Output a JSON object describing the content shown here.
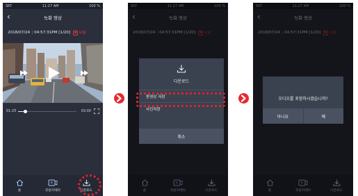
{
  "status": {
    "carrier": "SKT",
    "time": "11:27 AM",
    "battery": "100 %"
  },
  "header": {
    "title": "녹화 영상"
  },
  "recording": {
    "date": "2018/07/24",
    "time_count": "04:57:31PM [1/20]",
    "delete_label": "삭제"
  },
  "player": {
    "current_time": "01:25",
    "total_time": "03:00",
    "progress": 0.12
  },
  "nav": [
    {
      "label": "홈"
    },
    {
      "label": "후방카메라"
    },
    {
      "label": "다운로드"
    }
  ],
  "download_dialog": {
    "title": "다운로드",
    "options": [
      "동영상 저장",
      "사진저장"
    ],
    "cancel_label": "취소"
  },
  "audio_dialog": {
    "question": "오디오를 포함하시겠습니까?",
    "no_label": "아니요",
    "yes_label": "예"
  },
  "colors": {
    "highlight": "#d6262b",
    "background": "#2a2f3b",
    "arrow": "#e52a2f"
  }
}
